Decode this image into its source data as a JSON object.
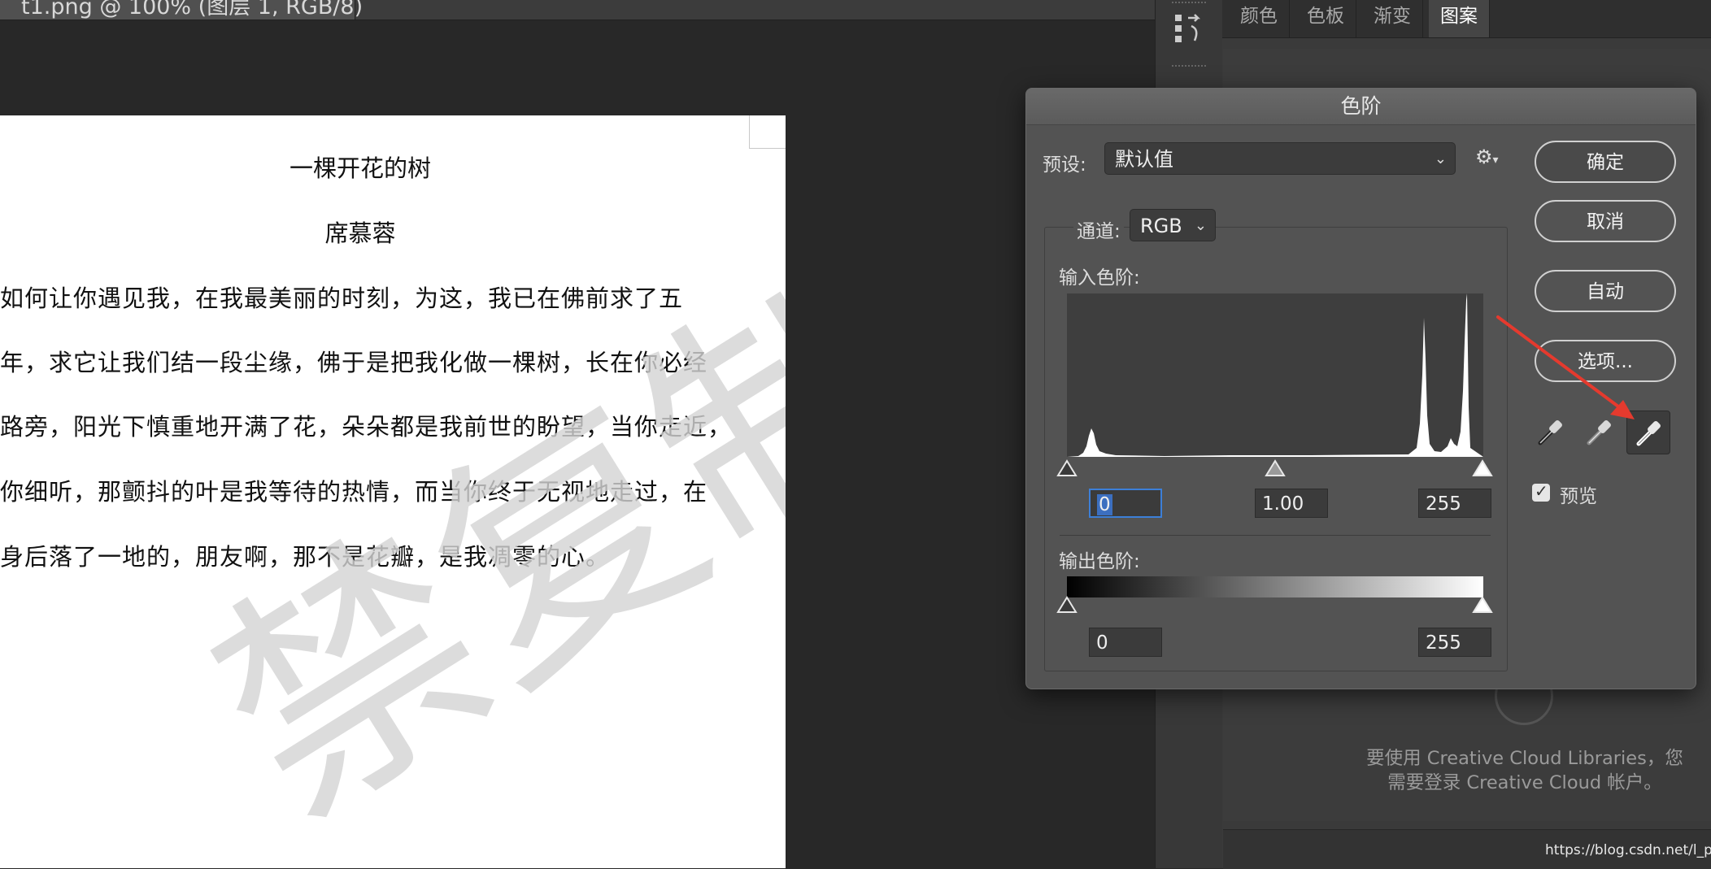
{
  "document": {
    "tab_label": "t1.png @ 100% (图层 1, RGB/8)",
    "poem_title": "一棵开花的树",
    "poem_author": "席慕蓉",
    "poem_lines": [
      "  如何让你遇见我，在我最美丽的时刻，为这，我已在佛前求了五",
      "年，求它让我们结一段尘缘，佛于是把我化做一棵树，长在你必经",
      "路旁，阳光下慎重地开满了花，朵朵都是我前世的盼望，当你走近，",
      "你细听，那颤抖的叶是我等待的热情，而当你终于无视地走过，在",
      "身后落了一地的，朋友啊，那不是花瓣，是我凋零的心。"
    ],
    "watermark": "禁复制"
  },
  "panels": {
    "tabs": [
      "颜色",
      "色板",
      "渐变",
      "图案"
    ],
    "active_tab": "图案",
    "cc_message_line1": "要使用 Creative Cloud Libraries，您",
    "cc_message_line2": "需要登录 Creative Cloud 帐户。",
    "url": "https://blog.csdn.net/l_peter"
  },
  "dialog": {
    "title": "色阶",
    "preset_label": "预设:",
    "preset_value": "默认值",
    "channel_label": "通道:",
    "channel_value": "RGB",
    "input_levels_label": "输入色阶:",
    "input_black": "0",
    "input_gamma": "1.00",
    "input_white": "255",
    "output_levels_label": "输出色阶:",
    "output_black": "0",
    "output_white": "255",
    "buttons": {
      "ok": "确定",
      "cancel": "取消",
      "auto": "自动",
      "options": "选项..."
    },
    "preview_label": "预览",
    "preview_checked": true,
    "eyedroppers": [
      "black-point",
      "gray-point",
      "white-point"
    ],
    "active_eyedropper": "white-point"
  },
  "colors": {
    "focus_blue": "#3c7fd8",
    "arrow_red": "#e53a2e"
  }
}
